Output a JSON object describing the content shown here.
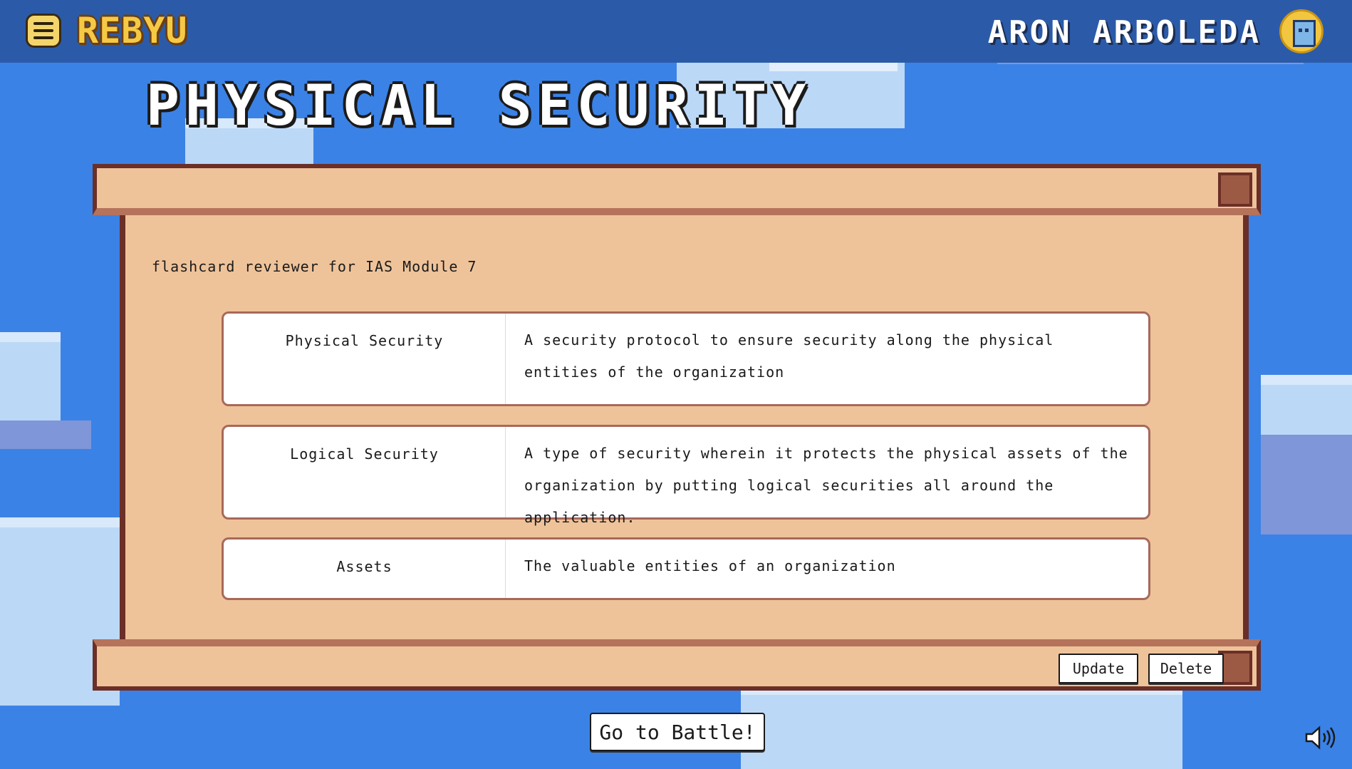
{
  "header": {
    "logo_text": "REBYU",
    "username": "ARON ARBOLEDA"
  },
  "page": {
    "title": "PHYSICAL SECURITY",
    "description": "flashcard reviewer for IAS Module 7"
  },
  "flashcards": [
    {
      "term": "Physical Security",
      "definition": "A security protocol to ensure security along the physical entities of the organization"
    },
    {
      "term": "Logical Security",
      "definition": "A type of security wherein it protects the physical assets of the organization by putting logical securities all around the application."
    },
    {
      "term": "Assets",
      "definition": "The valuable entities of an organization"
    }
  ],
  "actions": {
    "update_label": "Update",
    "delete_label": "Delete",
    "battle_label": "Go to Battle!"
  },
  "icons": {
    "menu": "hamburger-menu-icon",
    "avatar": "player-avatar-icon",
    "sound": "speaker-volume-icon"
  },
  "colors": {
    "sky": "#3b82e6",
    "header": "#2b5ba8",
    "scroll_paper": "#efc39a",
    "scroll_border": "#6b2f27",
    "logo": "#f6c945",
    "card_border": "#a8695a"
  }
}
